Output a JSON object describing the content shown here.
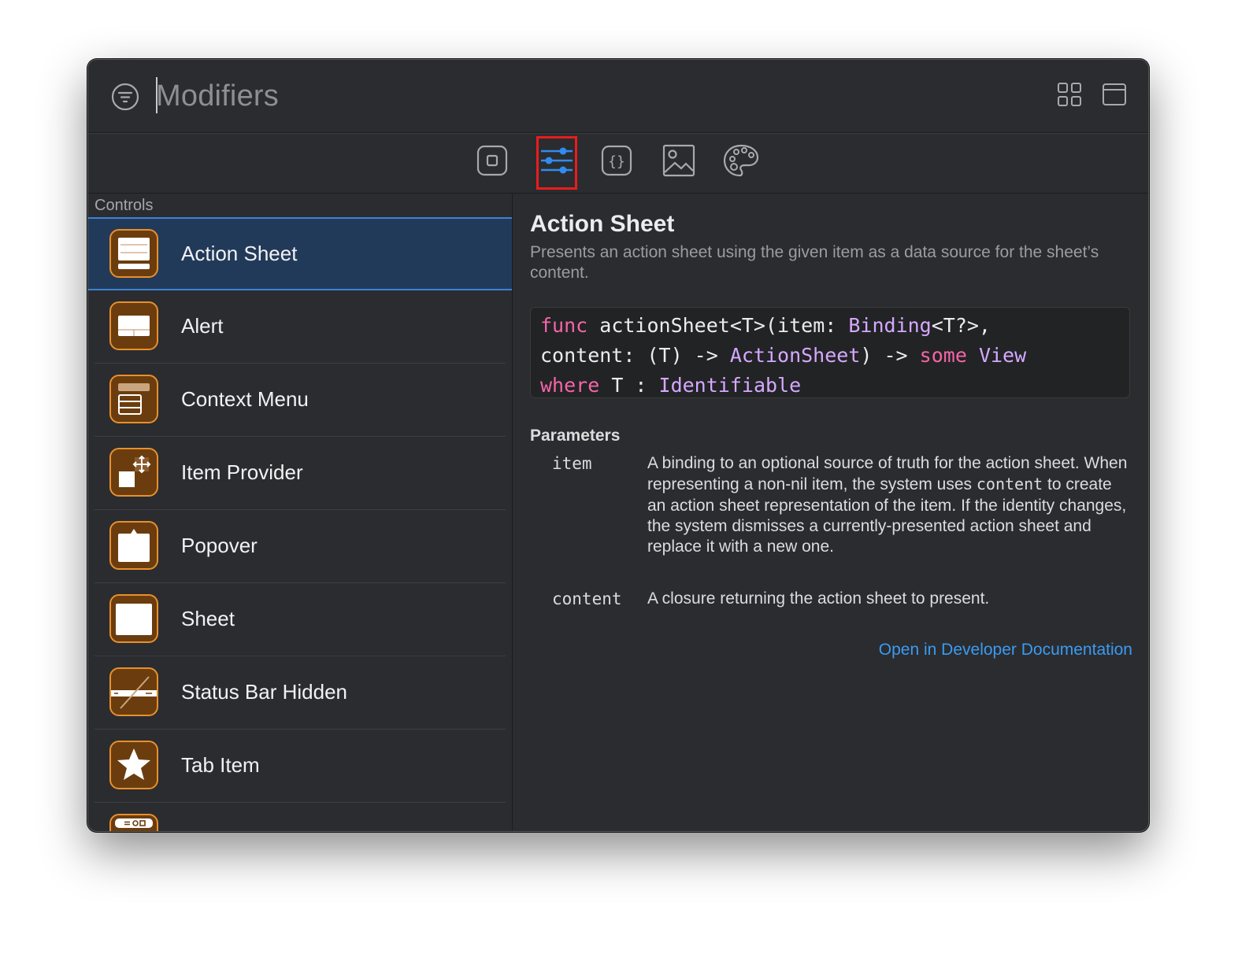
{
  "search": {
    "placeholder": "Modifiers"
  },
  "toolbar": {
    "icons": [
      "filter-icon",
      "grid-view-icon",
      "window-view-icon"
    ]
  },
  "tabs": [
    {
      "icon": "views-icon",
      "selected": false
    },
    {
      "icon": "modifiers-icon",
      "selected": true
    },
    {
      "icon": "code-snippets-icon",
      "selected": false
    },
    {
      "icon": "media-icon",
      "selected": false
    },
    {
      "icon": "color-palette-icon",
      "selected": false
    }
  ],
  "sidebar": {
    "section": "Controls",
    "items": [
      {
        "label": "Action Sheet",
        "icon": "action-sheet-icon",
        "selected": true
      },
      {
        "label": "Alert",
        "icon": "alert-icon"
      },
      {
        "label": "Context Menu",
        "icon": "context-menu-icon"
      },
      {
        "label": "Item Provider",
        "icon": "item-provider-icon"
      },
      {
        "label": "Popover",
        "icon": "popover-icon"
      },
      {
        "label": "Sheet",
        "icon": "sheet-icon"
      },
      {
        "label": "Status Bar Hidden",
        "icon": "status-bar-hidden-icon"
      },
      {
        "label": "Tab Item",
        "icon": "tab-item-icon"
      },
      {
        "label": "",
        "icon": "toolbar-icon"
      }
    ]
  },
  "detail": {
    "title": "Action Sheet",
    "summary": "Presents an action sheet using the given item as a data source for the sheet’s content.",
    "code": {
      "line1": {
        "kw1": "func",
        "t1": " actionSheet<T>(item: ",
        "ty1": "Binding",
        "t2": "<T?>,"
      },
      "line2": {
        "t1": "content: (T) -> ",
        "ty1": "ActionSheet",
        "t2": ") -> ",
        "kw1": "some",
        "t3": " ",
        "ty2": "View"
      },
      "line3": {
        "kw1": "where",
        "t1": " T : ",
        "ty1": "Identifiable"
      }
    },
    "parameters_title": "Parameters",
    "parameters": [
      {
        "name": "item",
        "desc_before": "A binding to an optional source of truth for the action sheet. When representing a non-nil item, the system uses ",
        "desc_code": "content",
        "desc_after": " to create an action sheet representation of the item. If the identity changes, the system dismisses a currently-presented action sheet and replace it with a new one."
      },
      {
        "name": "content",
        "desc": "A closure returning the action sheet to present."
      }
    ],
    "link": "Open in Developer Documentation"
  },
  "colors": {
    "background": "#2b2c2f",
    "accent": "#3a9bf2",
    "icon_fill": "#6b3d0e",
    "icon_border": "#e8902c",
    "keyword": "#f565a8",
    "type": "#d6a8ff",
    "highlight": "#e81d1d"
  }
}
